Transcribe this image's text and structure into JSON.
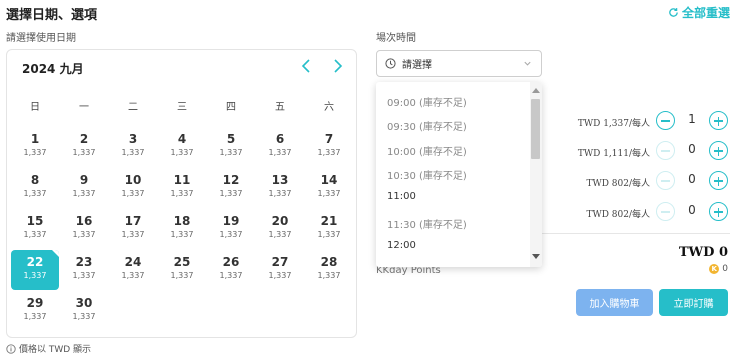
{
  "header": {
    "title": "選擇日期、選項",
    "reset_label": "全部重選"
  },
  "date_label": "請選擇使用日期",
  "time_label": "場次時間",
  "calendar": {
    "month_label": "2024 九月",
    "weekdays": [
      "日",
      "一",
      "二",
      "三",
      "四",
      "五",
      "六"
    ],
    "days": [
      {
        "day": "1",
        "price": "1,337"
      },
      {
        "day": "2",
        "price": "1,337"
      },
      {
        "day": "3",
        "price": "1,337"
      },
      {
        "day": "4",
        "price": "1,337"
      },
      {
        "day": "5",
        "price": "1,337"
      },
      {
        "day": "6",
        "price": "1,337"
      },
      {
        "day": "7",
        "price": "1,337"
      },
      {
        "day": "8",
        "price": "1,337"
      },
      {
        "day": "9",
        "price": "1,337"
      },
      {
        "day": "10",
        "price": "1,337"
      },
      {
        "day": "11",
        "price": "1,337"
      },
      {
        "day": "12",
        "price": "1,337"
      },
      {
        "day": "13",
        "price": "1,337"
      },
      {
        "day": "14",
        "price": "1,337"
      },
      {
        "day": "15",
        "price": "1,337"
      },
      {
        "day": "16",
        "price": "1,337"
      },
      {
        "day": "17",
        "price": "1,337"
      },
      {
        "day": "18",
        "price": "1,337"
      },
      {
        "day": "19",
        "price": "1,337"
      },
      {
        "day": "20",
        "price": "1,337"
      },
      {
        "day": "21",
        "price": "1,337"
      },
      {
        "day": "22",
        "price": "1,337"
      },
      {
        "day": "23",
        "price": "1,337"
      },
      {
        "day": "24",
        "price": "1,337"
      },
      {
        "day": "25",
        "price": "1,337"
      },
      {
        "day": "26",
        "price": "1,337"
      },
      {
        "day": "27",
        "price": "1,337"
      },
      {
        "day": "28",
        "price": "1,337"
      },
      {
        "day": "29",
        "price": "1,337"
      },
      {
        "day": "30",
        "price": "1,337"
      }
    ],
    "selected_day": "22",
    "price_note": "價格以 TWD 顯示"
  },
  "time_select": {
    "placeholder": "請選擇",
    "options": [
      {
        "label": "09:00 (庫存不足)",
        "available": false
      },
      {
        "label": "09:30 (庫存不足)",
        "available": false
      },
      {
        "label": "10:00 (庫存不足)",
        "available": false
      },
      {
        "label": "10:30 (庫存不足)",
        "available": false
      },
      {
        "label": "11:00",
        "available": true
      },
      {
        "label": "11:30 (庫存不足)",
        "available": false
      },
      {
        "label": "12:00",
        "available": true
      }
    ]
  },
  "quantities": [
    {
      "price": "TWD 1,337/每人",
      "qty": "1",
      "minus_enabled": true
    },
    {
      "price": "TWD 1,111/每人",
      "qty": "0",
      "minus_enabled": false
    },
    {
      "price": "TWD 802/每人",
      "qty": "0",
      "minus_enabled": false
    },
    {
      "price": "TWD 802/每人",
      "qty": "0",
      "minus_enabled": false
    }
  ],
  "summary": {
    "total": "TWD 0",
    "points_label": "KKday Points",
    "points_value": "0",
    "coin_glyph": "K"
  },
  "actions": {
    "add_to_cart": "加入購物車",
    "book_now": "立即訂購"
  },
  "colors": {
    "accent": "#26bec9",
    "cart_button": "#7db3ef",
    "coin": "#f2b531"
  }
}
